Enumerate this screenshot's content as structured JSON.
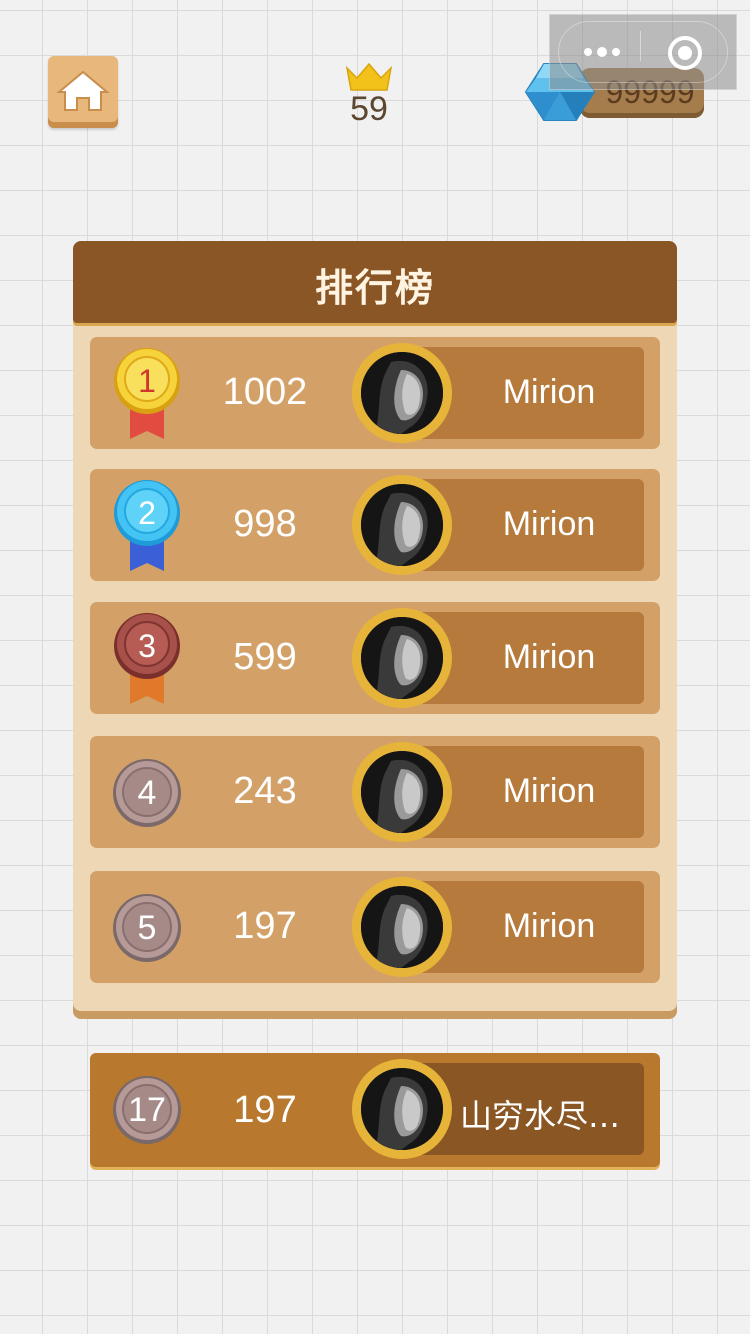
{
  "header": {
    "level": "59",
    "gems": "99999"
  },
  "panel": {
    "title": "排行榜"
  },
  "rows": [
    {
      "rank": "1",
      "score": "1002",
      "name": "Mirion",
      "medal": "gold"
    },
    {
      "rank": "2",
      "score": "998",
      "name": "Mirion",
      "medal": "blue"
    },
    {
      "rank": "3",
      "score": "599",
      "name": "Mirion",
      "medal": "bronze"
    },
    {
      "rank": "4",
      "score": "243",
      "name": "Mirion",
      "medal": "plain"
    },
    {
      "rank": "5",
      "score": "197",
      "name": "Mirion",
      "medal": "plain"
    }
  ],
  "me": {
    "rank": "17",
    "score": "197",
    "name": "山穷水尽…"
  },
  "colors": {
    "panel_header": "#8b5625",
    "panel_body": "#eed7b4",
    "row": "#d3a168",
    "row_namebar": "#b67b3c",
    "my_row": "#b8782d",
    "avatar_ring": "#e7b43a"
  },
  "icons": {
    "home": "home-icon",
    "crown": "crown-icon",
    "gem": "diamond-icon",
    "more": "more-dots-icon",
    "close": "target-circle-icon"
  }
}
